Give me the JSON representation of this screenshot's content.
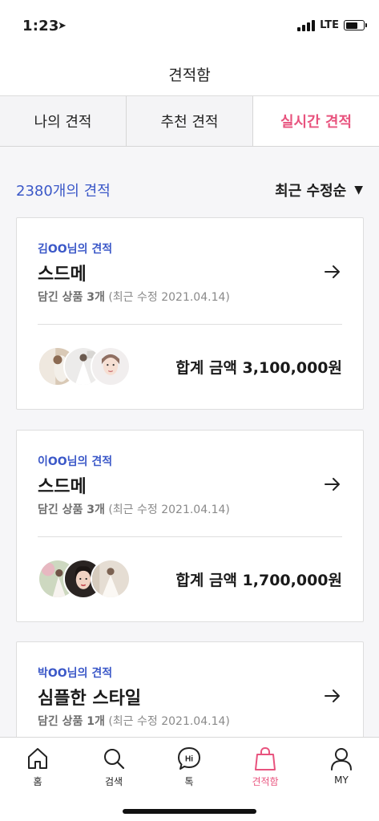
{
  "status_bar": {
    "time": "1:23",
    "network": "LTE"
  },
  "header": {
    "title": "견적함"
  },
  "tabs": [
    {
      "label": "나의 견적",
      "active": false
    },
    {
      "label": "추천 견적",
      "active": false
    },
    {
      "label": "실시간 견적",
      "active": true
    }
  ],
  "list": {
    "count_text": "2380개의 견적",
    "sort_label": "최근 수정순"
  },
  "cards": [
    {
      "owner": "김OO님의 견적",
      "name": "스드메",
      "items_label": "담긴 상품 3개",
      "updated": "(최근 수정 2021.04.14)",
      "total": "합계 금액 3,100,000원"
    },
    {
      "owner": "이OO님의 견적",
      "name": "스드메",
      "items_label": "담긴 상품 3개",
      "updated": "(최근 수정 2021.04.14)",
      "total": "합계 금액 1,700,000원"
    },
    {
      "owner": "박OO님의 견적",
      "name": "심플한 스타일",
      "items_label": "담긴 상품 1개",
      "updated": "(최근 수정 2021.04.14)",
      "total": ""
    }
  ],
  "bottom_nav": [
    {
      "label": "홈",
      "icon": "home-icon",
      "active": false
    },
    {
      "label": "검색",
      "icon": "search-icon",
      "active": false
    },
    {
      "label": "톡",
      "icon": "chat-icon",
      "active": false
    },
    {
      "label": "견적함",
      "icon": "shopping-bag-icon",
      "active": true
    },
    {
      "label": "MY",
      "icon": "person-icon",
      "active": false
    }
  ],
  "colors": {
    "accent": "#e8537e",
    "link": "#3b58c8",
    "text": "#1e1e1e",
    "muted": "#8a8a8a"
  }
}
